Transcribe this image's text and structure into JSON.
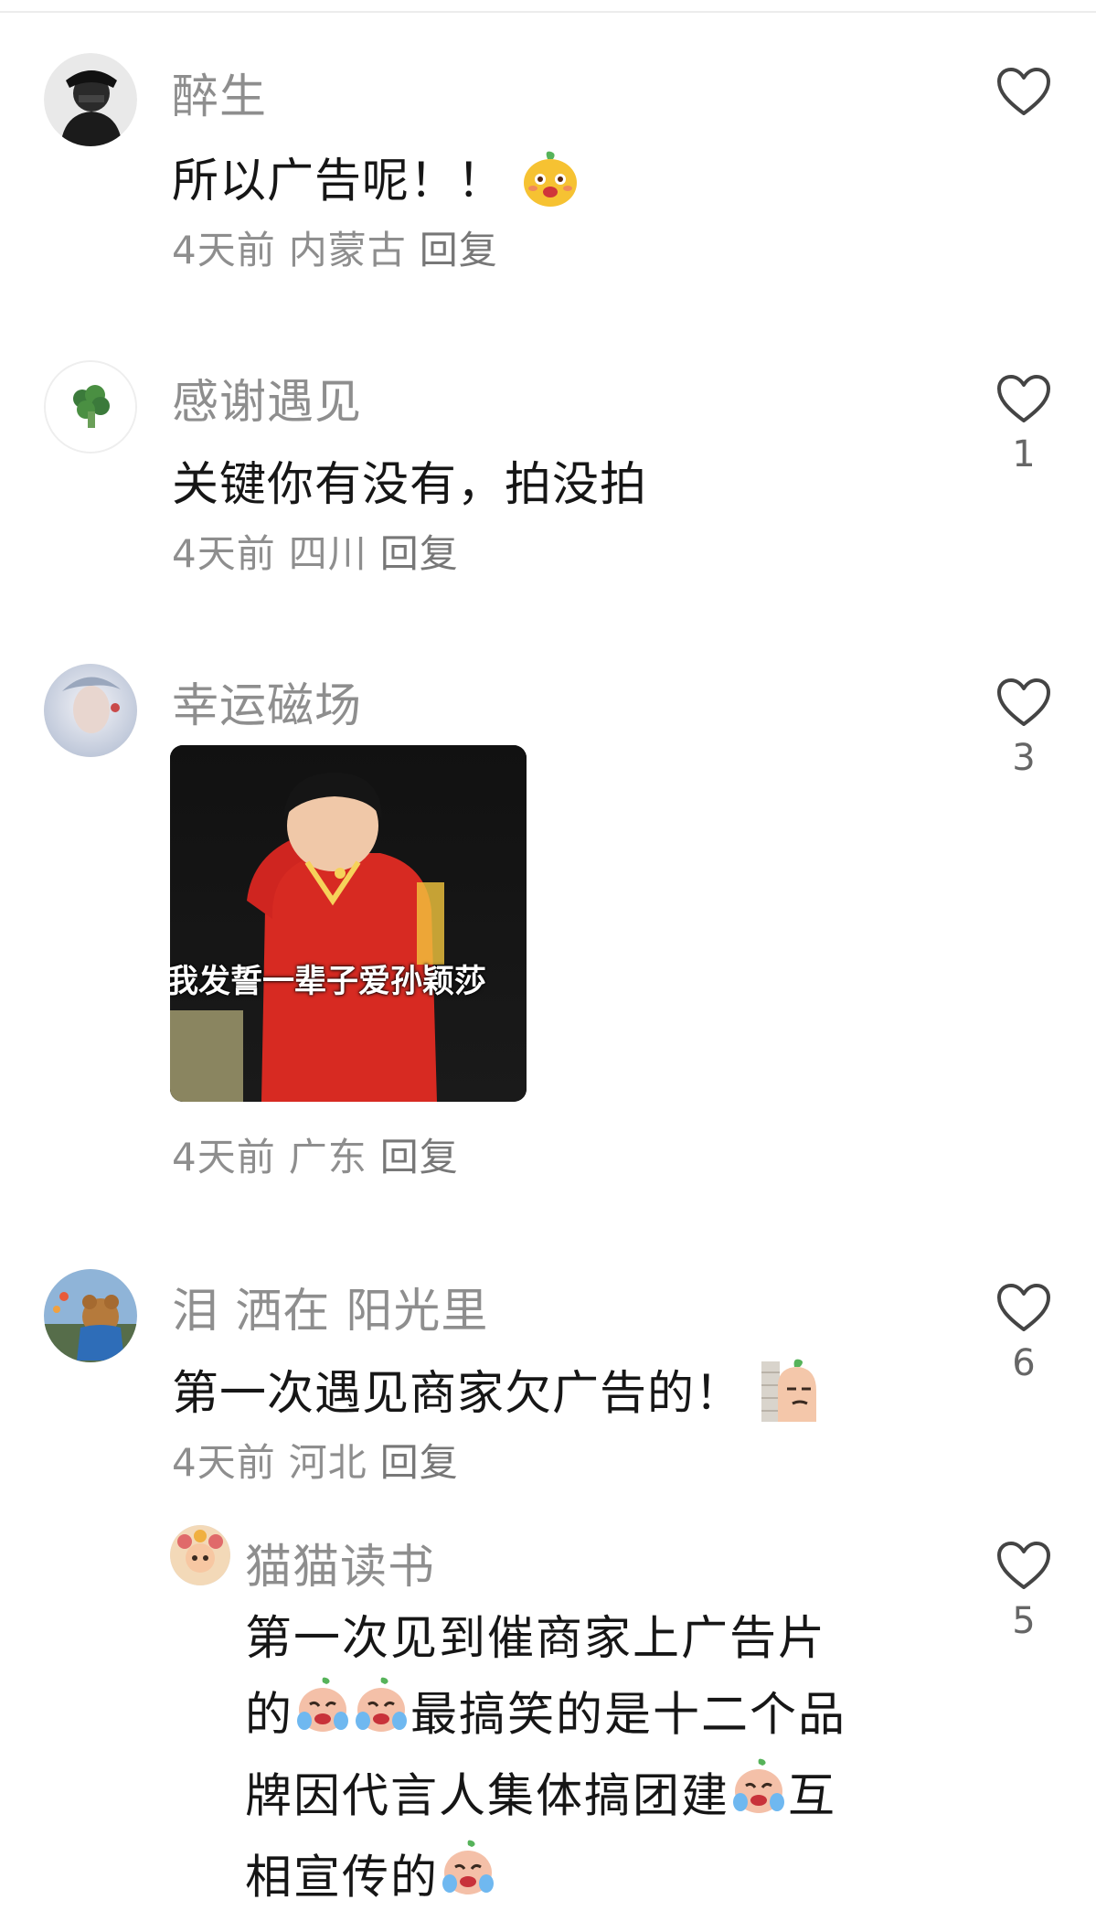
{
  "comments": [
    {
      "username": "醉生",
      "text": "所以广告呢！！",
      "time": "4天前",
      "location": "内蒙古",
      "reply": "回复",
      "likes": ""
    },
    {
      "username": "感谢遇见",
      "text": "关键你有没有，拍没拍",
      "time": "4天前",
      "location": "四川",
      "reply": "回复",
      "likes": "1"
    },
    {
      "username": "幸运磁场",
      "image_caption": "我发誓一辈子爱孙颖莎",
      "time": "4天前",
      "location": "广东",
      "reply": "回复",
      "likes": "3"
    },
    {
      "username": "泪 洒在 阳光里",
      "text": "第一次遇见商家欠广告的！",
      "time": "4天前",
      "location": "河北",
      "reply": "回复",
      "likes": "6"
    }
  ],
  "reply": {
    "username": "猫猫读书",
    "line1": "第一次见到催商家上广告片",
    "line2_a": "的",
    "line2_b": "最搞笑的是十二个品",
    "line3_a": "牌因代言人集体搞团建",
    "line3_b": "互",
    "line4": "相宣传的",
    "likes": "5"
  },
  "colors": {
    "username": "#8e8e8e",
    "text": "#161616",
    "meta": "#8e8e8e"
  }
}
